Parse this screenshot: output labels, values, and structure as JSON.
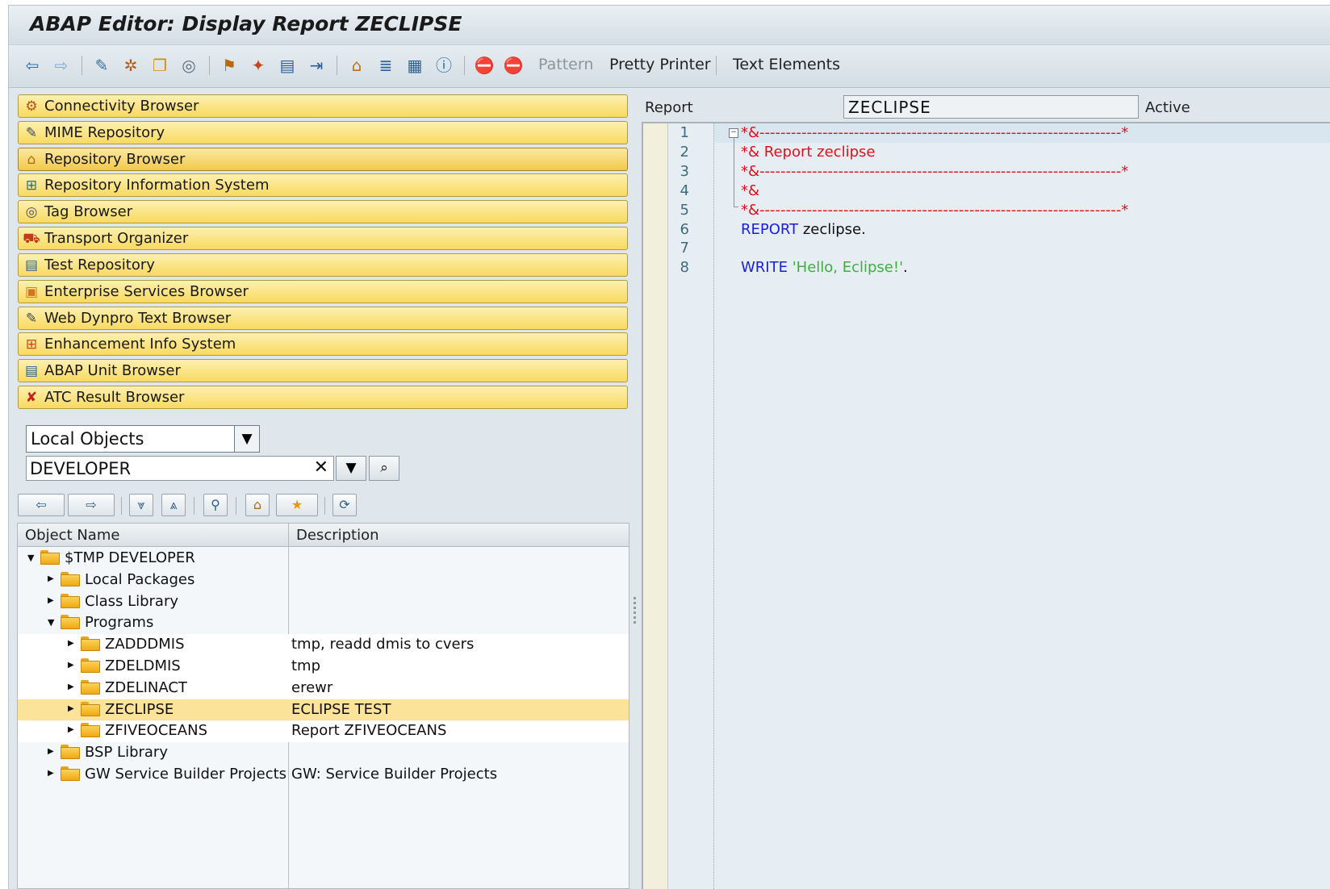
{
  "window": {
    "title": "ABAP Editor: Display Report ZECLIPSE"
  },
  "toolbar": {
    "icons": [
      "back-icon",
      "forward-icon",
      "display-change-icon",
      "active-inactive-icon",
      "other-object-icon",
      "check-icon",
      "activate-icon",
      "test-icon",
      "where-used-icon",
      "display-object-list-icon",
      "display-navigation-window-icon",
      "object-list-icon",
      "hierarchy-icon",
      "info-icon",
      "set-breakpoint-icon",
      "stop-breakpoint-icon"
    ],
    "pattern_label": "Pattern",
    "pretty_printer_label": "Pretty Printer",
    "text_elements_label": "Text Elements"
  },
  "nav": {
    "items": [
      {
        "label": "Connectivity Browser",
        "icon": "connectivity-icon"
      },
      {
        "label": "MIME Repository",
        "icon": "mime-icon"
      },
      {
        "label": "Repository Browser",
        "icon": "repository-icon"
      },
      {
        "label": "Repository Information System",
        "icon": "info-system-icon"
      },
      {
        "label": "Tag Browser",
        "icon": "tag-icon"
      },
      {
        "label": "Transport Organizer",
        "icon": "transport-icon"
      },
      {
        "label": "Test Repository",
        "icon": "test-icon"
      },
      {
        "label": "Enterprise Services Browser",
        "icon": "services-icon"
      },
      {
        "label": "Web Dynpro Text Browser",
        "icon": "text-browser-icon"
      },
      {
        "label": "Enhancement Info System",
        "icon": "enhancement-icon"
      },
      {
        "label": "ABAP Unit Browser",
        "icon": "unit-icon"
      },
      {
        "label": "ATC Result Browser",
        "icon": "atc-icon"
      }
    ]
  },
  "selector": {
    "object_type": "Local Objects",
    "object_name": "DEVELOPER",
    "clear_glyph": "✕"
  },
  "tree": {
    "columns": {
      "name": "Object Name",
      "description": "Description"
    },
    "rows": [
      {
        "name": "$TMP DEVELOPER",
        "desc": "",
        "level": 0,
        "expanded": true
      },
      {
        "name": "Local Packages",
        "desc": "",
        "level": 1,
        "expanded": false
      },
      {
        "name": "Class Library",
        "desc": "",
        "level": 1,
        "expanded": false
      },
      {
        "name": "Programs",
        "desc": "",
        "level": 1,
        "expanded": true
      },
      {
        "name": "ZADDDMIS",
        "desc": "tmp, readd dmis to cvers",
        "level": 2,
        "expanded": false
      },
      {
        "name": "ZDELDMIS",
        "desc": "tmp",
        "level": 2,
        "expanded": false
      },
      {
        "name": "ZDELINACT",
        "desc": "erewr",
        "level": 2,
        "expanded": false
      },
      {
        "name": "ZECLIPSE",
        "desc": "ECLIPSE TEST",
        "level": 2,
        "expanded": false,
        "selected": true
      },
      {
        "name": "ZFIVEOCEANS",
        "desc": "Report ZFIVEOCEANS",
        "level": 2,
        "expanded": false
      },
      {
        "name": "BSP Library",
        "desc": "",
        "level": 1,
        "expanded": false
      },
      {
        "name": "GW Service Builder Projects",
        "desc": "GW: Service Builder Projects",
        "level": 1,
        "expanded": false
      }
    ]
  },
  "editor": {
    "report_label": "Report",
    "report_name": "ZECLIPSE",
    "status": "Active",
    "lines": [
      {
        "num": "1",
        "parts": [
          {
            "t": "*&---------------------------------------------------------------------*",
            "c": "c-comment"
          }
        ]
      },
      {
        "num": "2",
        "parts": [
          {
            "t": "*& Report zeclipse",
            "c": "c-comment"
          }
        ]
      },
      {
        "num": "3",
        "parts": [
          {
            "t": "*&---------------------------------------------------------------------*",
            "c": "c-comment"
          }
        ]
      },
      {
        "num": "4",
        "parts": [
          {
            "t": "*&",
            "c": "c-comment"
          }
        ]
      },
      {
        "num": "5",
        "parts": [
          {
            "t": "*&---------------------------------------------------------------------*",
            "c": "c-comment"
          }
        ]
      },
      {
        "num": "6",
        "parts": [
          {
            "t": "REPORT",
            "c": "c-kw"
          },
          {
            "t": " zeclipse.",
            "c": "c-txt"
          }
        ]
      },
      {
        "num": "7",
        "parts": []
      },
      {
        "num": "8",
        "parts": [
          {
            "t": "WRITE",
            "c": "c-kw"
          },
          {
            "t": " 'Hello, Eclipse!'",
            "c": "c-str"
          },
          {
            "t": ".",
            "c": "c-txt"
          }
        ]
      }
    ]
  },
  "colors": {
    "nav_button": "#f8d960",
    "selected_row": "#fce39a",
    "comment": "#e0101a",
    "keyword": "#1a20d8",
    "string": "#3fae3f"
  }
}
